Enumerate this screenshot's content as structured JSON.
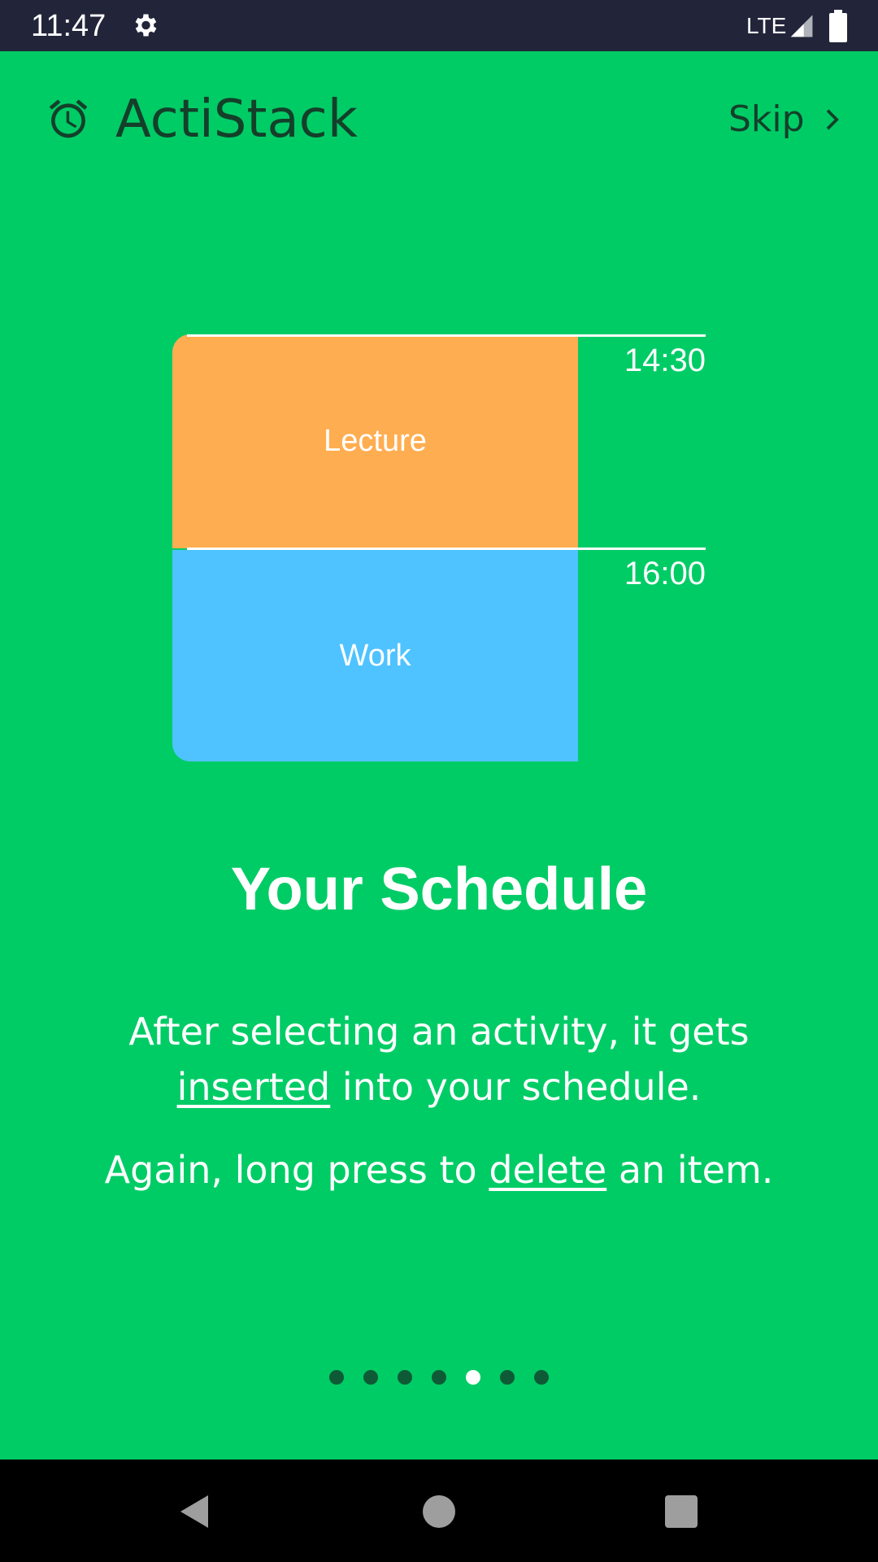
{
  "status_bar": {
    "time": "11:47",
    "network": "LTE",
    "icons": [
      "gear-icon",
      "signal-icon",
      "battery-icon"
    ]
  },
  "header": {
    "app_name": "ActiStack",
    "icon": "alarm-clock-icon",
    "skip_label": "Skip"
  },
  "illustration": {
    "blocks": [
      {
        "label": "Lecture",
        "color": "#FFAD51",
        "time": "14:30"
      },
      {
        "label": "Work",
        "color": "#4FC3FF",
        "time": "16:00"
      }
    ]
  },
  "page": {
    "title": "Your Schedule",
    "description_1": {
      "before": "After selecting an activity, it gets",
      "underlined": "inserted",
      "after": " into your schedule."
    },
    "description_2": {
      "before": "Again, long press to ",
      "underlined": "delete",
      "after": " an item."
    }
  },
  "pager": {
    "count": 7,
    "active_index": 4
  },
  "navigation": {
    "buttons": [
      "back-icon",
      "home-icon",
      "recents-icon"
    ]
  },
  "colors": {
    "background": "#00CC66",
    "status_bar": "#22253A",
    "header_text": "#14402A",
    "lecture": "#FFAD51",
    "work": "#4FC3FF"
  }
}
